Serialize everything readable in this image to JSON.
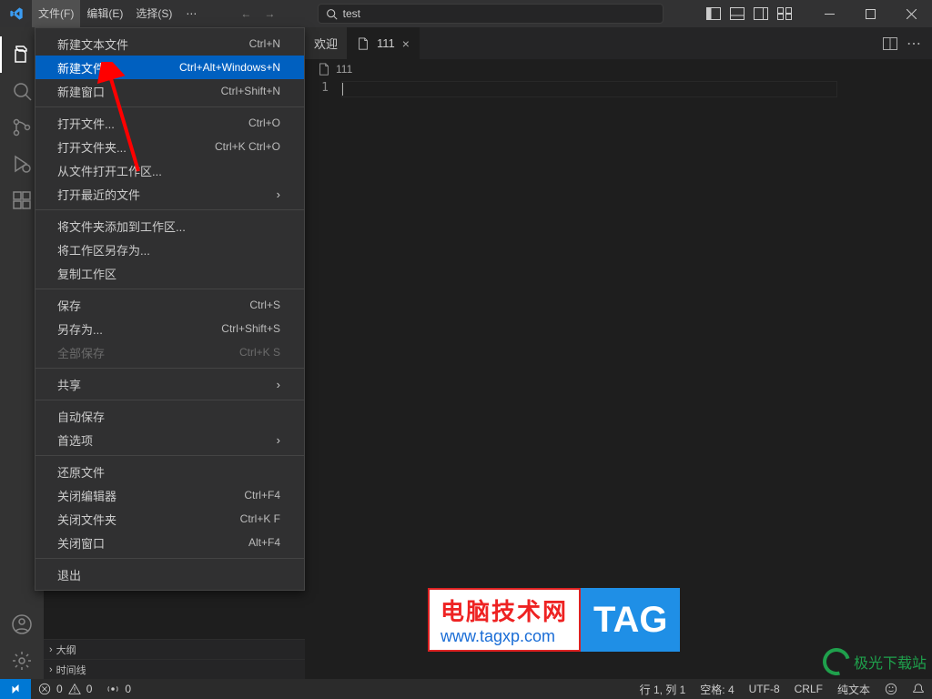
{
  "menubar": {
    "file": "文件(F)",
    "edit": "编辑(E)",
    "select": "选择(S)"
  },
  "search": {
    "text": "test"
  },
  "tabs": [
    {
      "label": "欢迎",
      "active": false
    },
    {
      "label": "111",
      "active": true
    }
  ],
  "breadcrumb": "111",
  "editor": {
    "line1": "1"
  },
  "outline": {
    "row1": "大纲",
    "row2": "时间线"
  },
  "status": {
    "errors": "0",
    "warnings": "0",
    "radio": "0",
    "lncol": "行 1, 列 1",
    "indent": "空格: 4",
    "enc": "UTF-8",
    "eol": "CRLF",
    "lang": "纯文本"
  },
  "file_menu": {
    "items": [
      {
        "label": "新建文本文件",
        "kb": "Ctrl+N"
      },
      {
        "label": "新建文件...",
        "kb": "Ctrl+Alt+Windows+N",
        "hl": true
      },
      {
        "label": "新建窗口",
        "kb": "Ctrl+Shift+N"
      },
      {
        "sep": true
      },
      {
        "label": "打开文件...",
        "kb": "Ctrl+O"
      },
      {
        "label": "打开文件夹...",
        "kb": "Ctrl+K Ctrl+O"
      },
      {
        "label": "从文件打开工作区..."
      },
      {
        "label": "打开最近的文件",
        "sub": true
      },
      {
        "sep": true
      },
      {
        "label": "将文件夹添加到工作区..."
      },
      {
        "label": "将工作区另存为..."
      },
      {
        "label": "复制工作区"
      },
      {
        "sep": true
      },
      {
        "label": "保存",
        "kb": "Ctrl+S"
      },
      {
        "label": "另存为...",
        "kb": "Ctrl+Shift+S"
      },
      {
        "label": "全部保存",
        "kb": "Ctrl+K S",
        "disabled": true
      },
      {
        "sep": true
      },
      {
        "label": "共享",
        "sub": true
      },
      {
        "sep": true
      },
      {
        "label": "自动保存"
      },
      {
        "label": "首选项",
        "sub": true
      },
      {
        "sep": true
      },
      {
        "label": "还原文件"
      },
      {
        "label": "关闭编辑器",
        "kb": "Ctrl+F4"
      },
      {
        "label": "关闭文件夹",
        "kb": "Ctrl+K F"
      },
      {
        "label": "关闭窗口",
        "kb": "Alt+F4"
      },
      {
        "sep": true
      },
      {
        "label": "退出"
      }
    ]
  },
  "watermark": {
    "t1": "电脑技术网",
    "t2": "www.tagxp.com",
    "tag": "TAG",
    "aurora": "极光下载站"
  }
}
